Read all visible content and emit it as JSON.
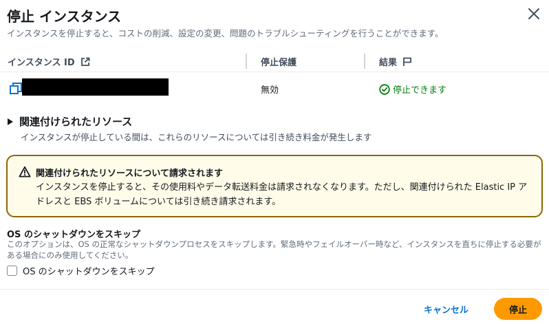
{
  "modal": {
    "title": "停止 インスタンス",
    "subtitle": "インスタンスを停止すると、コストの削減、設定の変更、問題のトラブルシューティングを行うことができます。"
  },
  "table": {
    "columns": {
      "instance_id": "インスタンス ID",
      "stop_protection": "停止保護",
      "result": "結果"
    },
    "rows": [
      {
        "stop_protection": "無効",
        "result": "停止できます"
      }
    ]
  },
  "related_resources": {
    "title": "関連付けられたリソース",
    "description": "インスタンスが停止している間は、これらのリソースについては引き続き料金が発生します"
  },
  "warning": {
    "title": "関連付けられたリソースについて請求されます",
    "body": "インスタンスを停止すると、その使用料やデータ転送料金は請求されなくなります。ただし、関連付けられた Elastic IP アドレスと EBS ボリュームについては引き続き請求されます。"
  },
  "os_shutdown": {
    "title": "OS のシャットダウンをスキップ",
    "description": "このオプションは、OS の正常なシャットダウンプロセスをスキップします。緊急時やフェイルオーバー時など、インスタンスを直ちに停止する必要がある場合にのみ使用してください。",
    "checkbox_label": "OS のシャットダウンをスキップ"
  },
  "footer": {
    "cancel_label": "キャンセル",
    "stop_label": "停止"
  },
  "icons": {
    "close": "close-icon",
    "external_link": "external-link-icon",
    "flag": "flag-icon",
    "copy": "copy-icon",
    "success": "check-circle-icon",
    "expand": "caret-right-icon",
    "warning": "warning-icon"
  },
  "colors": {
    "accent": "#0972d3",
    "success": "#037f0c",
    "warning_border": "#8d6605",
    "warning_bg": "#fffce9",
    "primary_button": "#ff9900"
  }
}
